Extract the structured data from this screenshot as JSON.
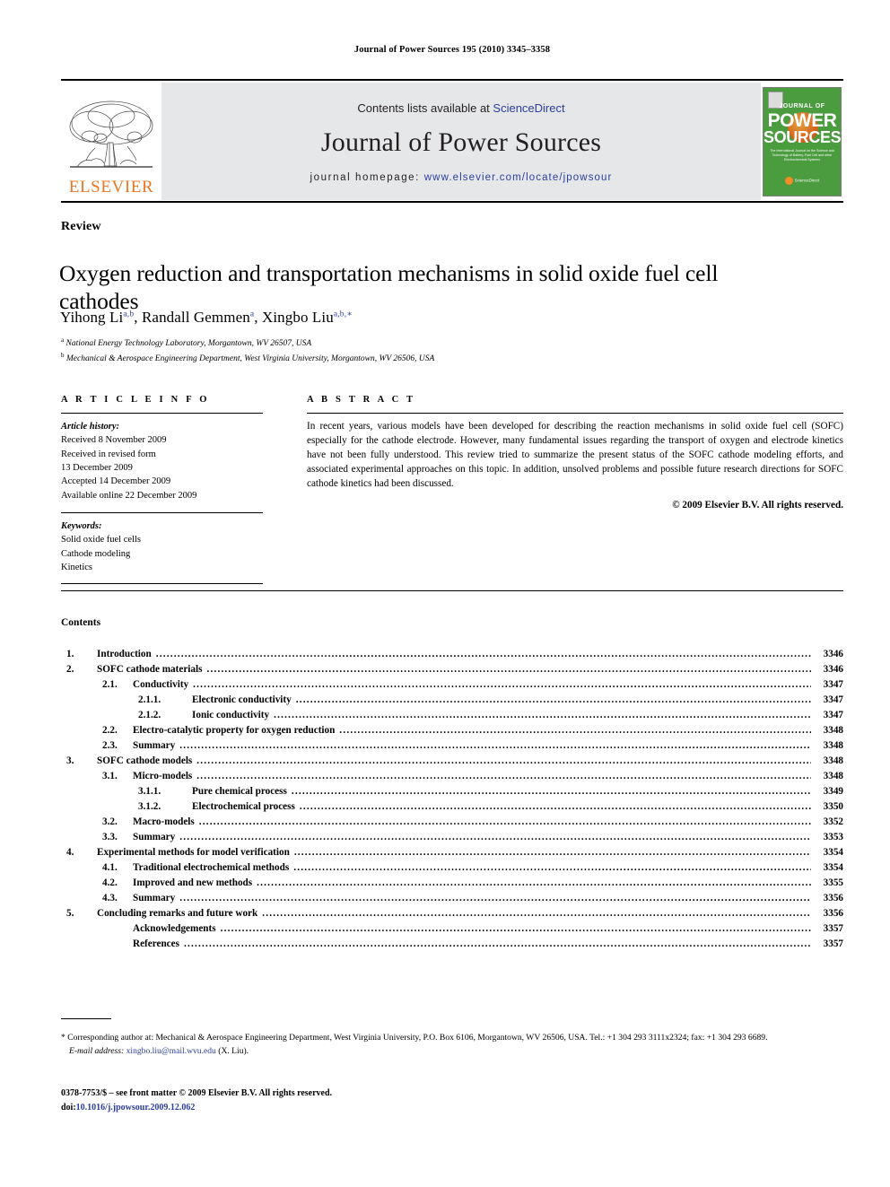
{
  "running_head": "Journal of Power Sources 195 (2010) 3345–3358",
  "masthead": {
    "contents_prefix": "Contents lists available at ",
    "sciencedirect": "ScienceDirect",
    "journal_title": "Journal of Power Sources",
    "homepage_label": "journal homepage:",
    "homepage_url": "www.elsevier.com/locate/jpowsour",
    "elsevier_wordmark": "ELSEVIER",
    "cover": {
      "line1": "JOURNAL OF",
      "line2": "POWER",
      "line3": "SOURCES",
      "subtitle": "The International Journal on the Science and Technology of Battery, Fuel Cell and other Electrochemical Systems",
      "sciencedirect": "ScienceDirect"
    },
    "link_color": "#2b3ea3",
    "band_color": "#e6e7e8",
    "cover_color": "#4b9b3f",
    "elsevier_orange": "#E87722"
  },
  "article": {
    "doctype": "Review",
    "title": "Oxygen reduction and transportation mechanisms in solid oxide fuel cell cathodes",
    "authors": [
      {
        "name": "Yihong Li",
        "sup": "a,b",
        "sep": ", "
      },
      {
        "name": "Randall Gemmen",
        "sup": "a",
        "sep": ", "
      },
      {
        "name": "Xingbo Liu",
        "sup": "a,b,∗",
        "sep": ""
      }
    ],
    "affiliations": [
      {
        "mark": "a",
        "text": "National Energy Technology Laboratory, Morgantown, WV 26507, USA"
      },
      {
        "mark": "b",
        "text": "Mechanical & Aerospace Engineering Department, West Virginia University, Morgantown, WV 26506, USA"
      }
    ]
  },
  "article_info": {
    "heading": "A R T I C L E    I N F O",
    "history_label": "Article history:",
    "history": [
      "Received 8 November 2009",
      "Received in revised form",
      "13 December 2009",
      "Accepted 14 December 2009",
      "Available online 22 December 2009"
    ],
    "keywords_label": "Keywords:",
    "keywords": [
      "Solid oxide fuel cells",
      "Cathode modeling",
      "Kinetics"
    ]
  },
  "abstract": {
    "heading": "A B S T R A C T",
    "text": "In recent years, various models have been developed for describing the reaction mechanisms in solid oxide fuel cell (SOFC) especially for the cathode electrode. However, many fundamental issues regarding the transport of oxygen and electrode kinetics have not been fully understood. This review tried to summarize the present status of the SOFC cathode modeling efforts, and associated experimental approaches on this topic. In addition, unsolved problems and possible future research directions for SOFC cathode kinetics had been discussed.",
    "copyright": "© 2009 Elsevier B.V. All rights reserved."
  },
  "contents": {
    "heading": "Contents",
    "entries": [
      {
        "level": 1,
        "num": "1.",
        "label": "Introduction",
        "page": "3346"
      },
      {
        "level": 1,
        "num": "2.",
        "label": "SOFC cathode materials",
        "page": "3346"
      },
      {
        "level": 2,
        "num": "2.1.",
        "label": "Conductivity",
        "page": "3347"
      },
      {
        "level": 3,
        "num": "2.1.1.",
        "label": "Electronic conductivity",
        "page": "3347"
      },
      {
        "level": 3,
        "num": "2.1.2.",
        "label": "Ionic conductivity",
        "page": "3347"
      },
      {
        "level": 2,
        "num": "2.2.",
        "label": "Electro-catalytic property for oxygen reduction",
        "page": "3348"
      },
      {
        "level": 2,
        "num": "2.3.",
        "label": "Summary",
        "page": "3348"
      },
      {
        "level": 1,
        "num": "3.",
        "label": "SOFC cathode models",
        "page": "3348"
      },
      {
        "level": 2,
        "num": "3.1.",
        "label": "Micro-models",
        "page": "3348"
      },
      {
        "level": 3,
        "num": "3.1.1.",
        "label": "Pure chemical process",
        "page": "3349"
      },
      {
        "level": 3,
        "num": "3.1.2.",
        "label": "Electrochemical process",
        "page": "3350"
      },
      {
        "level": 2,
        "num": "3.2.",
        "label": "Macro-models",
        "page": "3352"
      },
      {
        "level": 2,
        "num": "3.3.",
        "label": "Summary",
        "page": "3353"
      },
      {
        "level": 1,
        "num": "4.",
        "label": "Experimental methods for model verification",
        "page": "3354"
      },
      {
        "level": 2,
        "num": "4.1.",
        "label": "Traditional electrochemical methods",
        "page": "3354"
      },
      {
        "level": 2,
        "num": "4.2.",
        "label": "Improved and new methods",
        "page": "3355"
      },
      {
        "level": 2,
        "num": "4.3.",
        "label": "Summary",
        "page": "3356"
      },
      {
        "level": 1,
        "num": "5.",
        "label": "Concluding remarks and future work",
        "page": "3356"
      },
      {
        "level": 0,
        "num": "",
        "label": "Acknowledgements",
        "page": "3357"
      },
      {
        "level": 0,
        "num": "",
        "label": "References",
        "page": "3357"
      }
    ]
  },
  "footnotes": {
    "corresponding": "* Corresponding author at: Mechanical & Aerospace Engineering Department, West Virginia University, P.O. Box 6106, Morgantown, WV 26506, USA. Tel.: +1 304 293 3111x2324; fax: +1 304 293 6689.",
    "email_label": "E-mail address:",
    "email": "xingbo.liu@mail.wvu.edu",
    "email_suffix": "(X. Liu)."
  },
  "imprint": {
    "issn_line": "0378-7753/$ – see front matter © 2009 Elsevier B.V. All rights reserved.",
    "doi_label": "doi:",
    "doi": "10.1016/j.jpowsour.2009.12.062"
  }
}
